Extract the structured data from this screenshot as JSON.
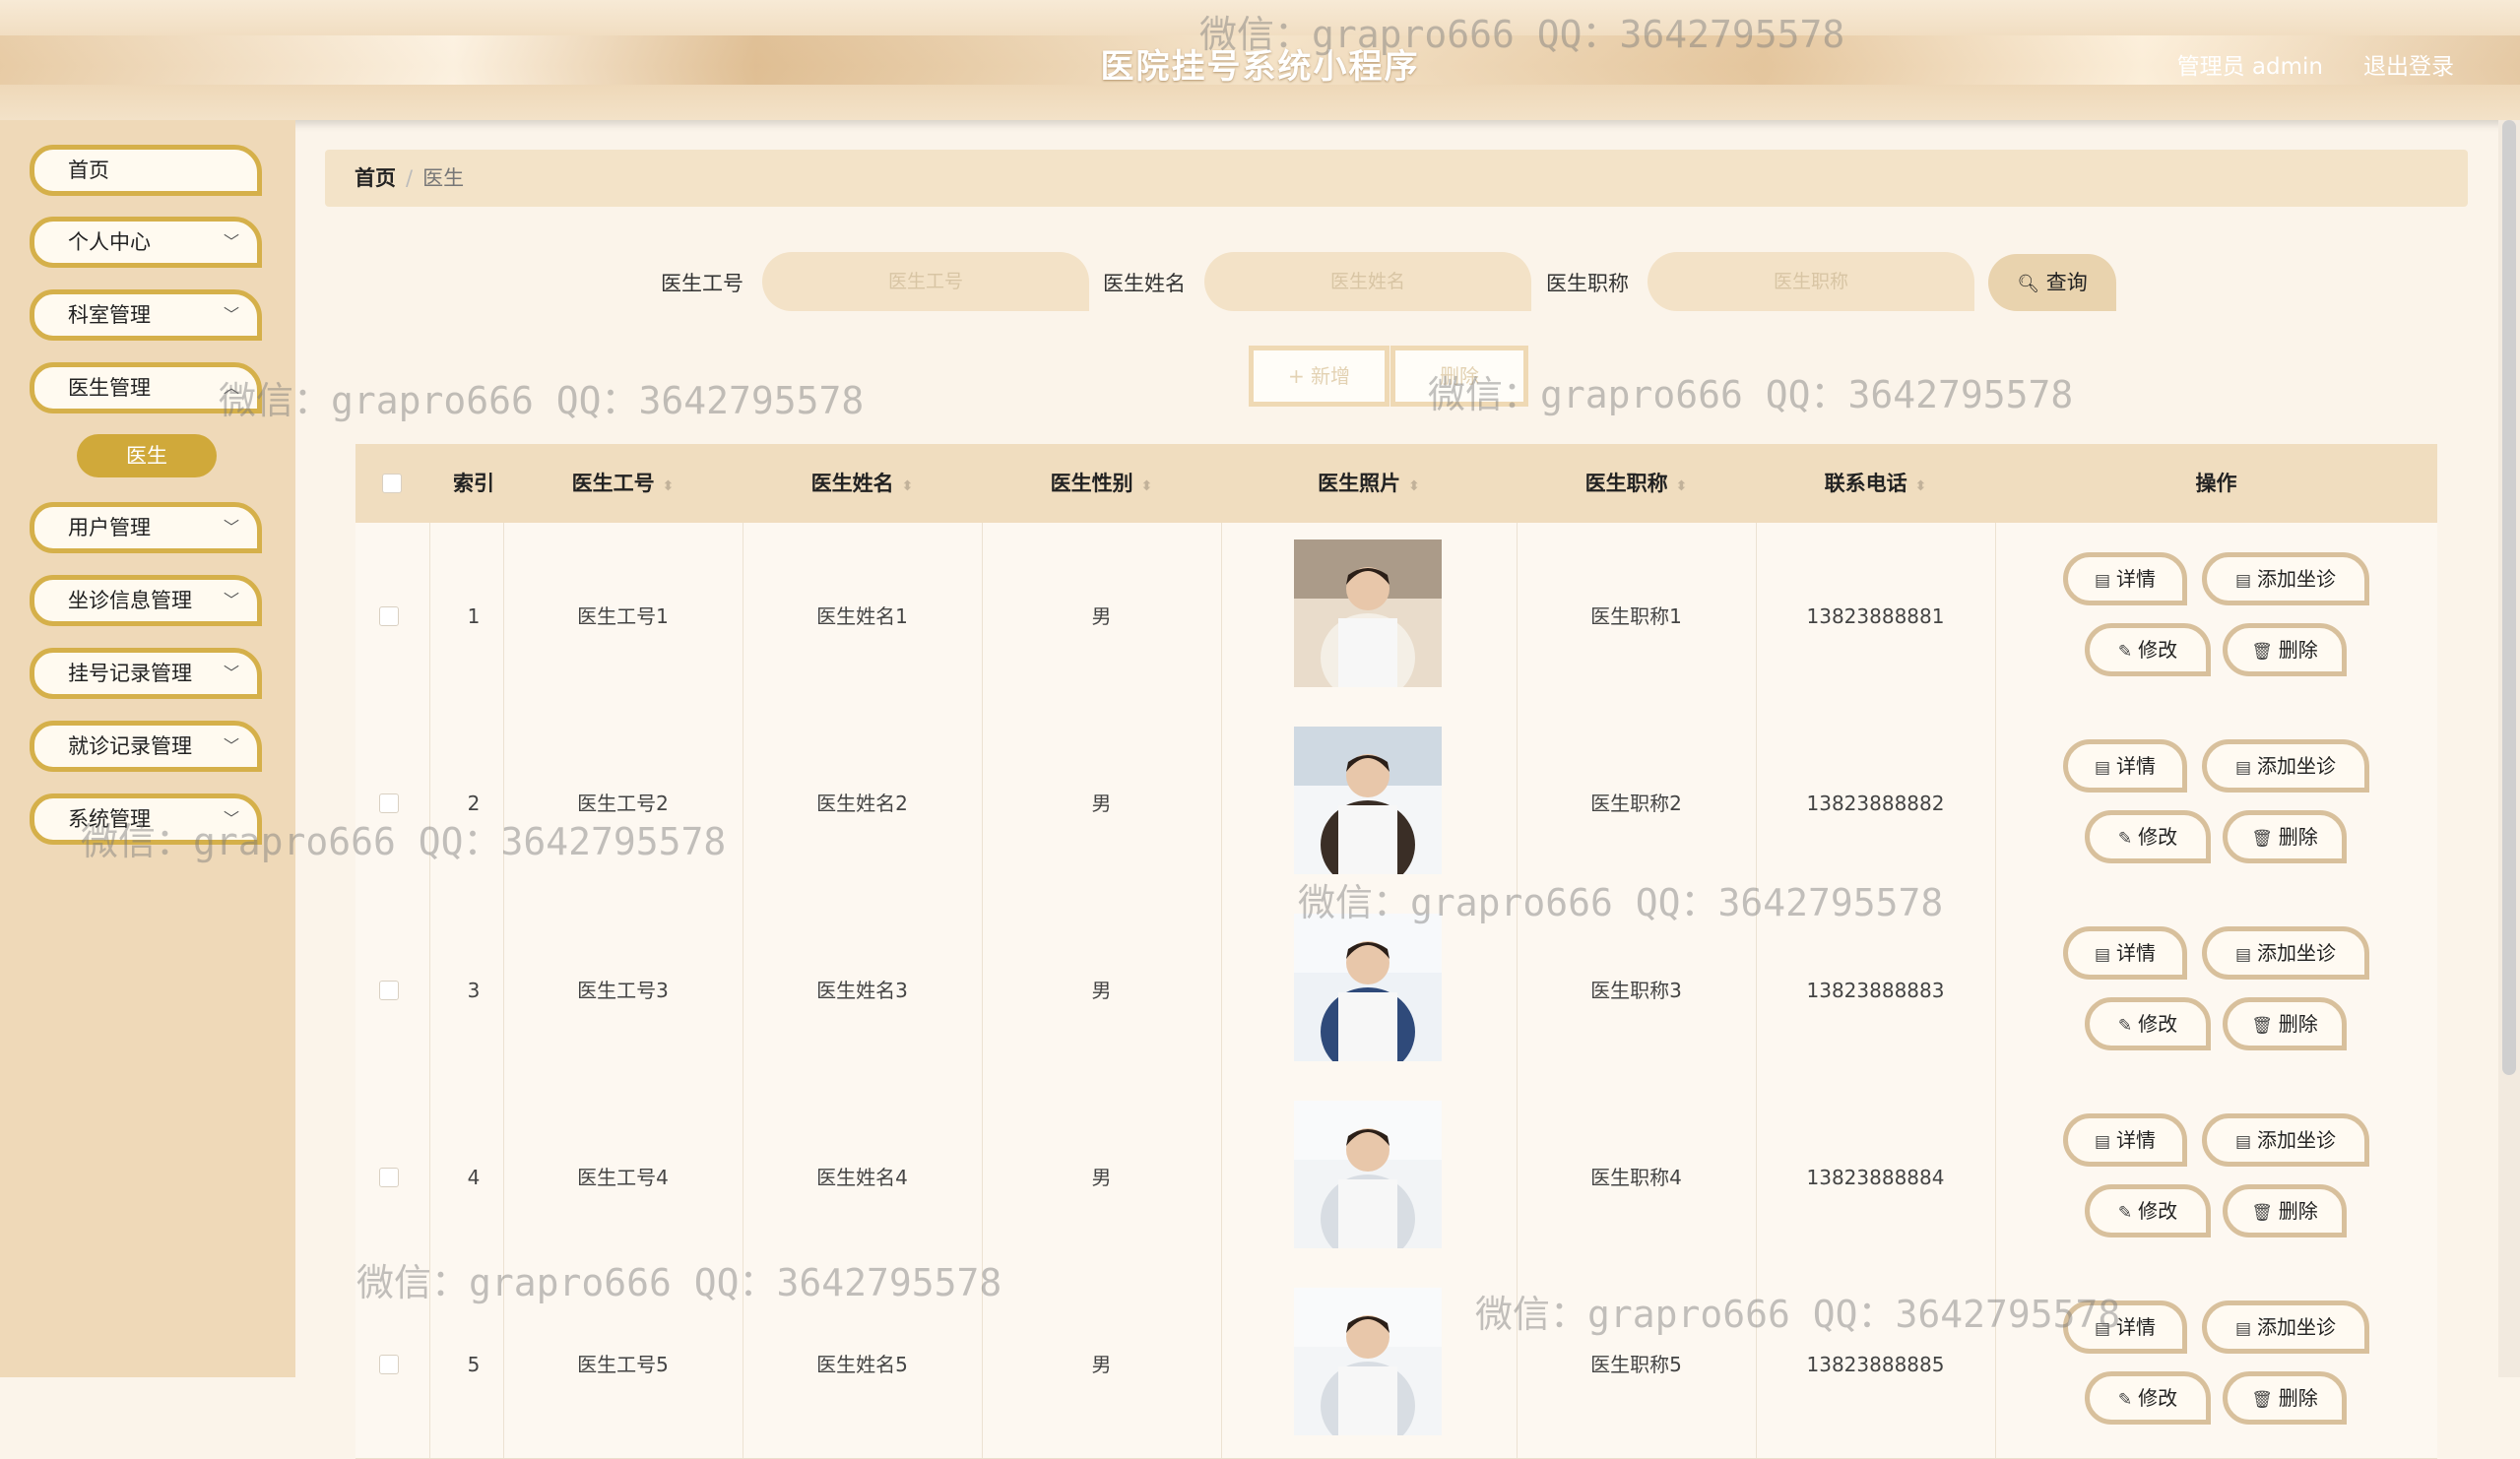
{
  "header": {
    "title": "医院挂号系统小程序",
    "admin_label": "管理员 admin",
    "logout_label": "退出登录"
  },
  "sidebar": {
    "items": [
      {
        "label": "首页",
        "has_chevron": false
      },
      {
        "label": "个人中心",
        "has_chevron": true
      },
      {
        "label": "科室管理",
        "has_chevron": true
      },
      {
        "label": "医生管理",
        "has_chevron": true
      },
      {
        "label": "用户管理",
        "has_chevron": true
      },
      {
        "label": "坐诊信息管理",
        "has_chevron": true
      },
      {
        "label": "挂号记录管理",
        "has_chevron": true
      },
      {
        "label": "就诊记录管理",
        "has_chevron": true
      },
      {
        "label": "系统管理",
        "has_chevron": true
      }
    ],
    "active_sub": "医生"
  },
  "breadcrumb": {
    "home": "首页",
    "separator": "/",
    "current": "医生"
  },
  "search": {
    "fields": [
      {
        "label": "医生工号",
        "placeholder": "医生工号"
      },
      {
        "label": "医生姓名",
        "placeholder": "医生姓名"
      },
      {
        "label": "医生职称",
        "placeholder": "医生职称"
      }
    ],
    "button_label": "查询"
  },
  "actions": {
    "add_label": "+ 新增",
    "delete_label": "删除"
  },
  "table": {
    "columns": [
      "索引",
      "医生工号",
      "医生姓名",
      "医生性别",
      "医生照片",
      "医生职称",
      "联系电话",
      "操作"
    ],
    "rows": [
      {
        "index": "1",
        "id": "医生工号1",
        "name": "医生姓名1",
        "gender": "男",
        "title": "医生职称1",
        "phone": "13823888881"
      },
      {
        "index": "2",
        "id": "医生工号2",
        "name": "医生姓名2",
        "gender": "男",
        "title": "医生职称2",
        "phone": "13823888882"
      },
      {
        "index": "3",
        "id": "医生工号3",
        "name": "医生姓名3",
        "gender": "男",
        "title": "医生职称3",
        "phone": "13823888883"
      },
      {
        "index": "4",
        "id": "医生工号4",
        "name": "医生姓名4",
        "gender": "男",
        "title": "医生职称4",
        "phone": "13823888884"
      },
      {
        "index": "5",
        "id": "医生工号5",
        "name": "医生姓名5",
        "gender": "男",
        "title": "医生职称5",
        "phone": "13823888885"
      }
    ],
    "row_actions": {
      "detail": "详情",
      "add_visit": "添加坐诊",
      "edit": "修改",
      "delete": "删除"
    }
  },
  "watermark": "微信：grapro666 QQ：3642795578",
  "colors": {
    "accent": "#d0a93a",
    "header": "#ecd3b0",
    "sidebar": "#efd9b8"
  }
}
